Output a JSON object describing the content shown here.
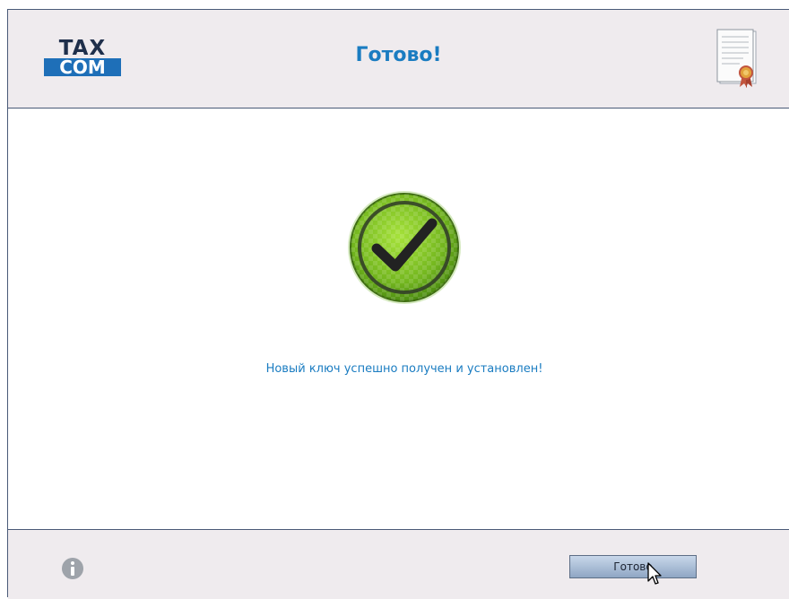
{
  "header": {
    "logo_top": "TAX",
    "logo_bottom": "COM",
    "title": "Готово!",
    "document_icon": "certificate-document-icon"
  },
  "main": {
    "status_icon": "success-checkmark-icon",
    "message": "Новый ключ успешно получен и установлен!"
  },
  "footer": {
    "info_icon": "info-icon",
    "done_label": "Готово",
    "cursor_icon": "mouse-pointer-icon"
  },
  "colors": {
    "accent": "#1a7cc1",
    "header_bg": "#efebee",
    "border": "#4a5a78",
    "success_green": "#7cc520",
    "button_gradient_top": "#c8d7ea",
    "button_gradient_bottom": "#8fa6c4"
  }
}
